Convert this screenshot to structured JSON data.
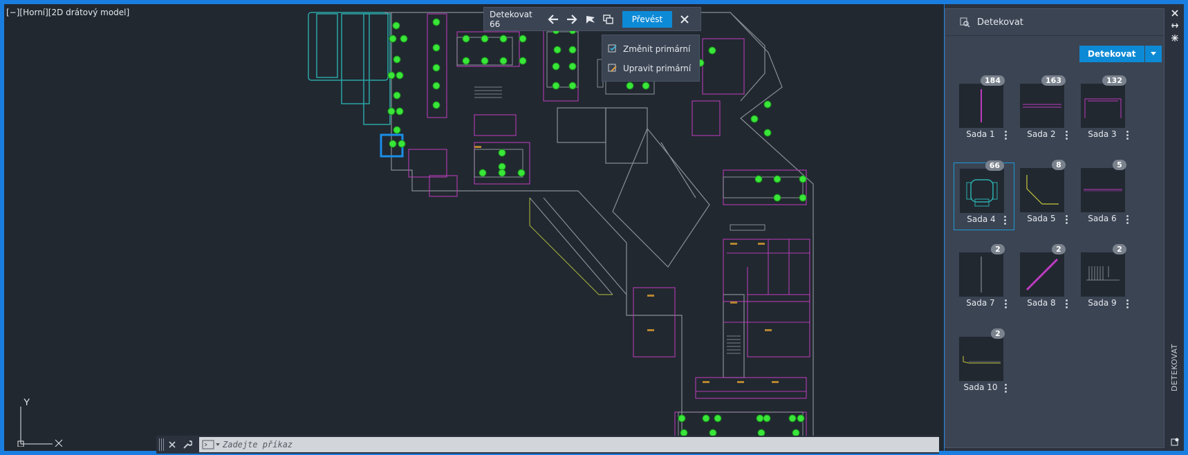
{
  "viewport": {
    "label": "[−][Horní][2D drátový model]"
  },
  "ucs": {
    "y": "Y",
    "x": "X"
  },
  "detect_toolbar": {
    "label": "Detekovat 66",
    "convert_label": "Převést",
    "icons": [
      "arrow-left-icon",
      "arrow-right-icon",
      "flag-icon",
      "copy-icon",
      "close-icon"
    ]
  },
  "detect_menu": {
    "items": [
      {
        "label": "Změnit primární",
        "icon": "change-primary-icon"
      },
      {
        "label": "Upravit primární",
        "icon": "edit-primary-icon"
      }
    ]
  },
  "command_line": {
    "placeholder": "Zadejte příkaz"
  },
  "palette": {
    "title": "Detekovat",
    "detect_button": "Detekovat",
    "vertical_label": "DETEKOVAT",
    "sets": [
      {
        "label": "Sada 1",
        "count": "184"
      },
      {
        "label": "Sada 2",
        "count": "163"
      },
      {
        "label": "Sada 3",
        "count": "132"
      },
      {
        "label": "Sada 4",
        "count": "66"
      },
      {
        "label": "Sada 5",
        "count": "8"
      },
      {
        "label": "Sada 6",
        "count": "5"
      },
      {
        "label": "Sada 7",
        "count": "2"
      },
      {
        "label": "Sada 8",
        "count": "2"
      },
      {
        "label": "Sada 9",
        "count": "2"
      },
      {
        "label": "Sada 10",
        "count": "2"
      }
    ],
    "selected_set": "Sada 4"
  },
  "colors": {
    "viewport_bg": "#212830",
    "frame": "#1a7ee0",
    "accent": "#0d8ad6",
    "marker_green": "#39e639",
    "wall_magenta": "#c03ac0",
    "wall_gray": "#8a8f96"
  }
}
